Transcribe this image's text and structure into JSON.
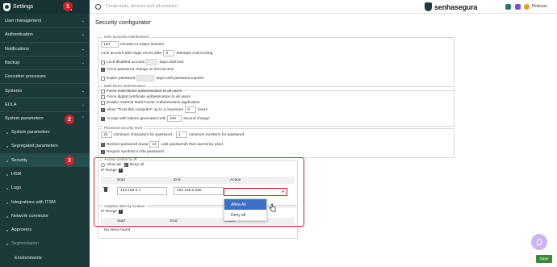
{
  "sidebar": {
    "title": "Settings",
    "items": [
      {
        "label": "User management",
        "has_chevron": true
      },
      {
        "label": "Authentication",
        "has_chevron": true
      },
      {
        "label": "Notifications",
        "has_chevron": true
      },
      {
        "label": "Backup",
        "has_chevron": true
      },
      {
        "label": "Execution processes",
        "has_chevron": false
      },
      {
        "label": "Systems",
        "has_chevron": true
      },
      {
        "label": "EULA",
        "has_chevron": true
      },
      {
        "label": "System parameters",
        "has_chevron": true
      }
    ],
    "sub_items": [
      "System parameters",
      "Segregated parameters",
      "Security",
      "HSM",
      "Logo",
      "Integrations with ITSM",
      "Network connector",
      "Approvers",
      "Segmentation"
    ],
    "subsub_items": [
      "Environments"
    ],
    "badges": [
      "1",
      "2",
      "3"
    ]
  },
  "topbar": {
    "search_placeholder": "Credentials, devices and information",
    "brand": "senhasegura",
    "user": "Robson"
  },
  "page": {
    "title": "Security configurator"
  },
  "user_accounts": {
    "legend": "User accounts maintenance",
    "expire_value": "120",
    "expire_label": "minutes to expire session",
    "lock_after_label": "Lock account after login errors after",
    "lock_attempts_value": "5",
    "lock_attempts_label": "attempts until locking",
    "lock_disabled_label": "Lock disabled account",
    "lock_disabled_value": "",
    "lock_disabled_suffix": "days until lock",
    "force_password_label": "Force password change on first access",
    "expire_password_label": "Expire password",
    "expire_password_value": "",
    "expire_password_suffix": "days until password expires"
  },
  "mfa": {
    "legend": "Multi-factor authentication",
    "force_mfa_label": "Force multi-factor authentication to all users",
    "force_cert_label": "Force digital certificate authentication to all users",
    "enable_external_label": "Enable external Multi-Factor Authentication application",
    "allow_trust_label": "Allow \"Trust this computer\" up to a maximum",
    "allow_trust_value": "8",
    "allow_trust_suffix": "hours",
    "accept_tokens_label": "Accept with tokens generated until",
    "accept_tokens_value": "240",
    "accept_tokens_suffix": "second change"
  },
  "password_security": {
    "legend": "Password security level",
    "min_chars_value": "10",
    "min_chars_label": "minimum characters for password",
    "min_numbers_value": "1",
    "min_numbers_label": "minimum numbers for password",
    "restrict_label": "Restrict password reuse",
    "restrict_value": "12",
    "restrict_suffix": "Last passwords that cannot by used",
    "require_symbols_label": "Require symbols in the password"
  },
  "access_control": {
    "legend": "Access control by IP",
    "allow_all_label": "Allow all",
    "deny_all_label": "Deny all",
    "ip_range_label": "IP Range",
    "columns": [
      "",
      "Start",
      "End",
      "Action"
    ],
    "row": {
      "start": "192.168.0.1",
      "end": "192.168.0.255",
      "action": ""
    },
    "dropdown_options": [
      "Allow All",
      "Deny all"
    ]
  },
  "adaptive_mfa": {
    "legend": "Adaptive MFA by location",
    "ip_range_label": "IP Range",
    "columns": [
      "",
      "Start",
      "End",
      "Action"
    ],
    "empty_text": "No items found"
  },
  "actions": {
    "save_label": "Save"
  },
  "colors": {
    "sidebar_bg": "#1c3a3a",
    "highlight_red": "#d12028",
    "save_green": "#3a8a3a",
    "dropdown_highlight": "#3d6fc6"
  }
}
